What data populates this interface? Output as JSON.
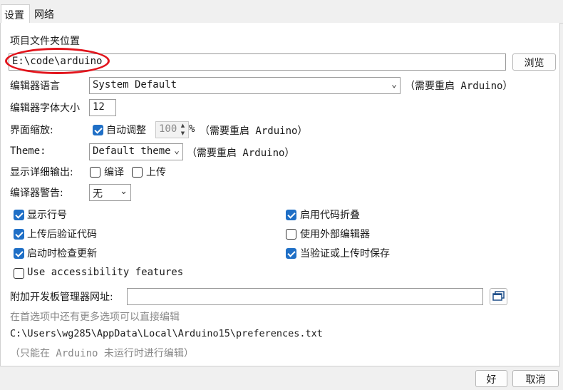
{
  "tabs": [
    {
      "label": "设置",
      "active": true
    },
    {
      "label": "网络",
      "active": false
    }
  ],
  "sketchbook": {
    "label": "项目文件夹位置",
    "value": "E:\\code\\arduino",
    "browse_label": "浏览"
  },
  "editor_language": {
    "label": "编辑器语言",
    "selected": "System Default",
    "note": "（需要重启 Arduino）"
  },
  "font_size": {
    "label": "编辑器字体大小",
    "value": "12"
  },
  "scale": {
    "label": "界面缩放:",
    "auto_label": "自动调整",
    "auto_checked": true,
    "value": "100",
    "unit": "%",
    "note": "（需要重启 Arduino）"
  },
  "theme": {
    "label": "Theme:",
    "selected": "Default theme",
    "note": "（需要重启 Arduino）"
  },
  "verbose": {
    "label": "显示详细输出:",
    "compile_label": "编译",
    "compile_checked": false,
    "upload_label": "上传",
    "upload_checked": false
  },
  "warnings": {
    "label": "编译器警告:",
    "selected": "无"
  },
  "options_left": [
    {
      "label": "显示行号",
      "checked": true
    },
    {
      "label": "上传后验证代码",
      "checked": true
    },
    {
      "label": "启动时检查更新",
      "checked": true
    },
    {
      "label": "Use accessibility features",
      "checked": false
    }
  ],
  "options_right": [
    {
      "label": "启用代码折叠",
      "checked": true
    },
    {
      "label": "使用外部编辑器",
      "checked": false
    },
    {
      "label": "当验证或上传时保存",
      "checked": true
    }
  ],
  "board_urls": {
    "label": "附加开发板管理器网址:",
    "value": ""
  },
  "more_prefs_text": "在首选项中还有更多选项可以直接编辑",
  "prefs_path": "C:\\Users\\wg285\\AppData\\Local\\Arduino15\\preferences.txt",
  "edit_note": "（只能在 Arduino 未运行时进行编辑）",
  "buttons": {
    "ok_label": "好",
    "cancel_label": "取消"
  },
  "colors": {
    "accent": "#1f6fc6",
    "highlight_oval": "#e2141c"
  },
  "icons": {
    "dropdown": "chevron-down-icon",
    "url_editor": "window-stack-icon"
  }
}
